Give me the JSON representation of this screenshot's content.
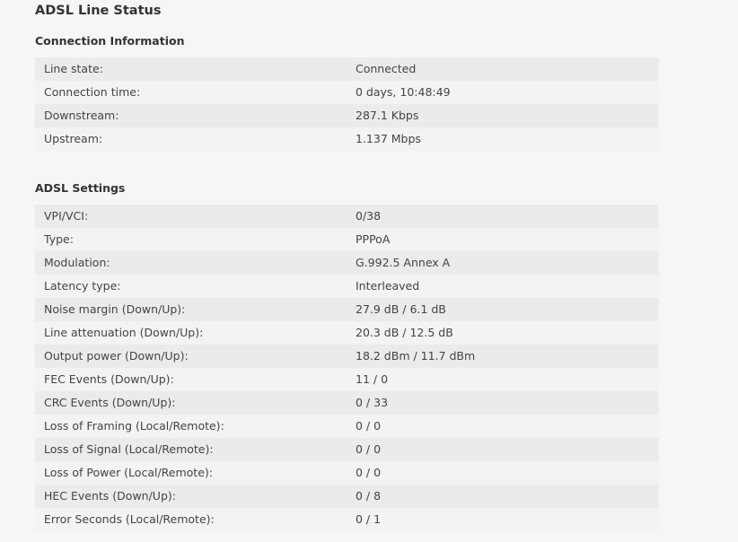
{
  "page": {
    "title": "ADSL Line Status"
  },
  "connection_info": {
    "title": "Connection Information",
    "rows": [
      {
        "label": "Line state:",
        "value": "Connected"
      },
      {
        "label": "Connection time:",
        "value": "0 days, 10:48:49"
      },
      {
        "label": "Downstream:",
        "value": "287.1 Kbps"
      },
      {
        "label": "Upstream:",
        "value": "1.137 Mbps"
      }
    ]
  },
  "adsl_settings": {
    "title": "ADSL Settings",
    "rows": [
      {
        "label": "VPI/VCI:",
        "value": "0/38"
      },
      {
        "label": "Type:",
        "value": "PPPoA"
      },
      {
        "label": "Modulation:",
        "value": "G.992.5 Annex A"
      },
      {
        "label": "Latency type:",
        "value": "Interleaved"
      },
      {
        "label": "Noise margin (Down/Up):",
        "value": "27.9 dB / 6.1 dB"
      },
      {
        "label": "Line attenuation (Down/Up):",
        "value": "20.3 dB / 12.5 dB"
      },
      {
        "label": "Output power (Down/Up):",
        "value": "18.2 dBm / 11.7 dBm"
      },
      {
        "label": "FEC Events (Down/Up):",
        "value": "11 / 0"
      },
      {
        "label": "CRC Events (Down/Up):",
        "value": "0 / 33"
      },
      {
        "label": "Loss of Framing (Local/Remote):",
        "value": "0 / 0"
      },
      {
        "label": "Loss of Signal (Local/Remote):",
        "value": "0 / 0"
      },
      {
        "label": "Loss of Power (Local/Remote):",
        "value": "0 / 0"
      },
      {
        "label": "HEC Events (Down/Up):",
        "value": "0 / 8"
      },
      {
        "label": "Error Seconds (Local/Remote):",
        "value": "0 / 1"
      }
    ]
  },
  "colors": {
    "background": "#f6f6f6",
    "row_dark": "#ebebeb",
    "row_light": "#f3f3f3",
    "text": "#444444",
    "heading": "#333333"
  }
}
